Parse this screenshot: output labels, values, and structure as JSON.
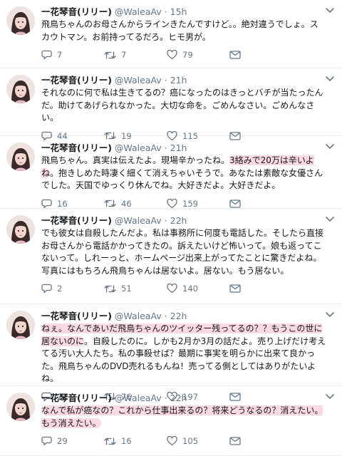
{
  "tweets": [
    {
      "name": "一花琴音(リリー)",
      "handle": "@WaleaAv",
      "dot": "·",
      "time": "15h",
      "parts": [
        {
          "t": "飛鳥ちゃんのお母さんからラインきたんですけど。。絶対違うでしょ。スカウトマン。お前持ってるだろ。ヒモ男が。",
          "hl": false
        }
      ],
      "reply": "7",
      "retweet": "7",
      "like": "79",
      "height": 96
    },
    {
      "name": "一花琴音(リリー)",
      "handle": "@WaleaAv",
      "dot": "·",
      "time": "21h",
      "parts": [
        {
          "t": "それなのに何で私は生きてるの？癌になったのはきっとバチが当たったんだ。助けてあげられなかった。大切な命を。ごめんなさい。ごめんなさい。",
          "hl": false
        }
      ],
      "reply": "44",
      "retweet": "19",
      "like": "115",
      "height": 95
    },
    {
      "name": "一花琴音(リリー)",
      "handle": "@WaleaAv",
      "dot": "·",
      "time": "21h",
      "parts": [
        {
          "t": "飛鳥ちゃん。真実は伝えたよ。現場辛かったね。",
          "hl": false
        },
        {
          "t": "3絡みで20万は辛いよね",
          "hl": true
        },
        {
          "t": "。抱きしめた時凄く細くて消えちゃいそうで。あなたは素敵な女優さんでした。天国でゆっくり休んでね。大好きだよ。大好きだよ。",
          "hl": false
        }
      ],
      "reply": "16",
      "retweet": "46",
      "like": "159",
      "height": 102
    },
    {
      "name": "一花琴音(リリー)",
      "handle": "@WaleaAv",
      "dot": "·",
      "time": "22h",
      "parts": [
        {
          "t": "でも彼女は自殺したんだよ。私は事務所に何度も電話した。そしたら直接お母さんから電話かかってきたの。訴えたいけど怖いって。娘も返ってこないって。しれーっと、ホームページ出来上がってたことに驚きだよね。写真にはもちろん飛鳥ちゃんは居ないよ。居ない。もう居ない。",
          "hl": false
        }
      ],
      "reply": "2",
      "retweet": "51",
      "like": "140",
      "height": 134
    },
    {
      "name": "一花琴音(リリー)",
      "handle": "@WaleaAv",
      "dot": "·",
      "time": "22h",
      "parts": [
        {
          "t": "ねぇ。なんであいだ飛鳥ちゃんのツイッター残ってるの？？もうこの世に居ないのに",
          "hl": true
        },
        {
          "t": "。自殺したのに。しかも2月か3月の話だよ。売り上げだけ考えてる汚い大人たち。私の事殺せば？最期に事実を明らかに出来て良かった。飛鳥ちゃんのDVD売れるもんね！売ってる側としてはありがたいよね。",
          "hl": false
        }
      ],
      "reply": "22",
      "retweet": "76",
      "like": "197",
      "height": 115
    },
    {
      "name": "一花琴音(リリー)",
      "handle": "@WaleaAv",
      "dot": "·",
      "time": "22h",
      "parts": [
        {
          "t": "なんで私が癌なの？これから仕事出来るの？将来どうなるの？消えたい。もう消えたい。",
          "hl": true
        }
      ],
      "reply": "29",
      "retweet": "16",
      "like": "105",
      "height": 98
    }
  ],
  "colors": {
    "muted": "#657786",
    "divider": "#e6ecf0",
    "highlight": "#f0789655"
  }
}
